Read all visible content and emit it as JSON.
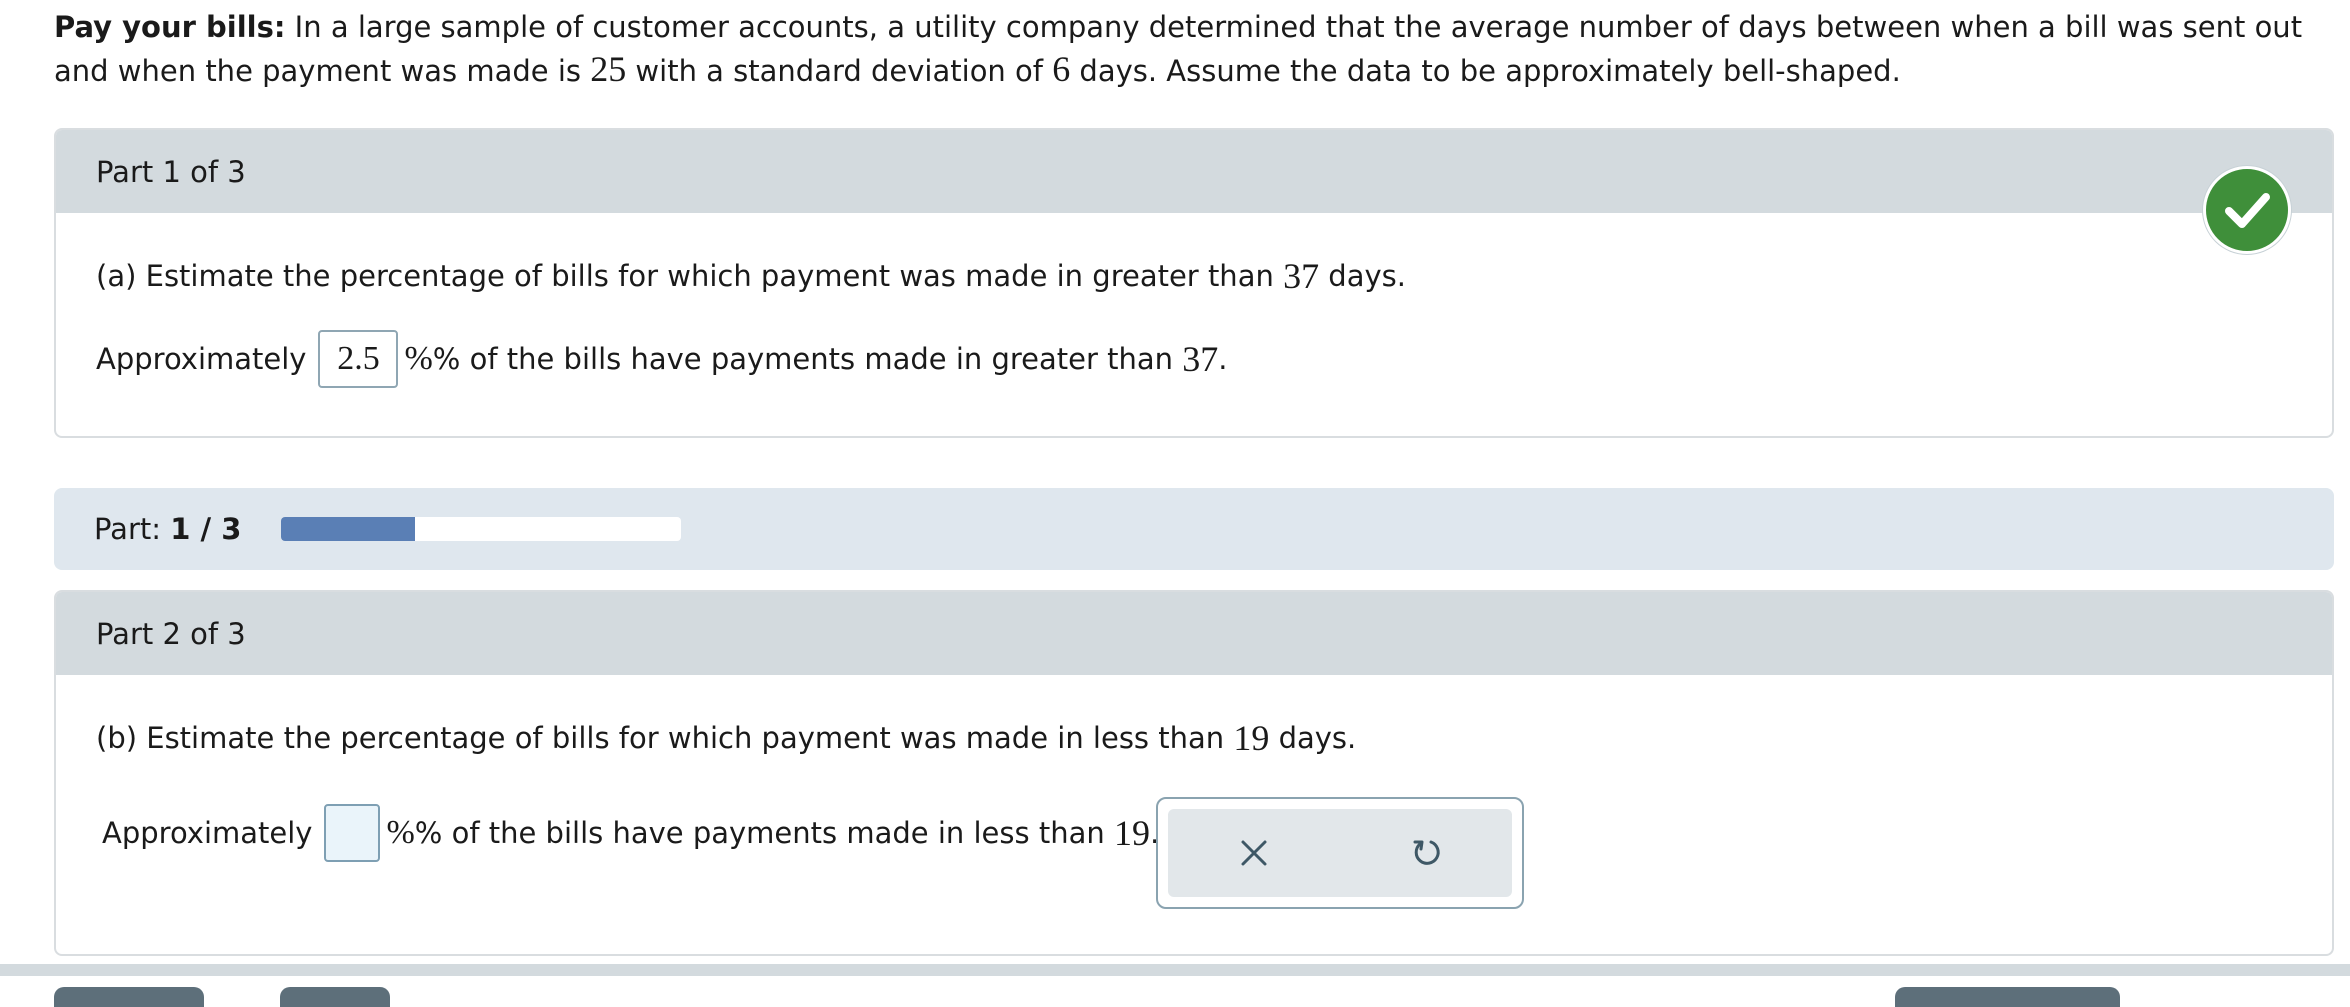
{
  "intro": {
    "bold": "Pay your bills:",
    "text1": " In a large sample of customer accounts, a utility company determined that the average number of days between when a bill was sent out and when the payment was made is ",
    "mean": "25",
    "text2": " with a standard deviation of ",
    "sd": "6",
    "text3": " days. Assume the data to be approximately bell-shaped."
  },
  "part1": {
    "header": "Part 1 of 3",
    "question_pre": "(a) Estimate the percentage of bills for which payment was made in greater than ",
    "question_num": "37",
    "question_post": " days.",
    "answer_pre": "Approximately",
    "answer_value": "2.5",
    "answer_post": "% of the bills have payments made in greater than ",
    "answer_num": "37",
    "answer_end": ".",
    "status": "correct"
  },
  "progress": {
    "label": "Part: ",
    "value_text": "1 / 3",
    "fraction": 0.333,
    "accent": "#5a7fb5"
  },
  "part2": {
    "header": "Part 2 of 3",
    "question_pre": "(b) Estimate the percentage of bills for which payment was made in less than ",
    "question_num": "19",
    "question_post": " days.",
    "answer_pre": "Approximately",
    "answer_value": "",
    "answer_post": "% of the bills have payments made in less than ",
    "answer_num": "19",
    "answer_end": "."
  },
  "tools": {
    "clear_icon": "close-icon",
    "undo_icon": "undo-icon"
  },
  "colors": {
    "check_green": "#3f8f3a",
    "header_gray": "#d3dade"
  }
}
